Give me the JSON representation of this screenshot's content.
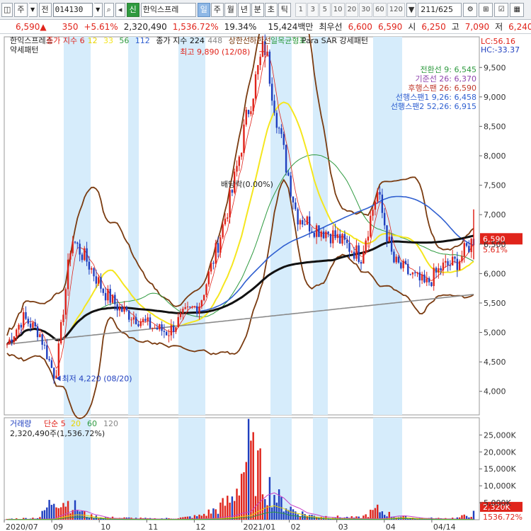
{
  "toolbar": {
    "type_label": "주",
    "prev_label": "전",
    "code": "014130",
    "tag": "신",
    "name": "한익스프레",
    "periods": [
      "일",
      "주",
      "월",
      "년",
      "분",
      "초",
      "틱"
    ],
    "active_period": "일",
    "numbers": [
      "1",
      "3",
      "5",
      "10",
      "20",
      "30",
      "60",
      "120"
    ],
    "count": "211/625"
  },
  "quote": {
    "price": "6,590▲",
    "change": "350",
    "change_pct": "+5.61%",
    "volume": "2,320,490",
    "volume_pct": "1,536.72%",
    "turnover_pct": "19.34%",
    "amount": "15,424백만",
    "best_ask_label": "최우선",
    "best_ask_1": "6,600",
    "best_ask_2": "6,590",
    "open_label": "시",
    "open": "6,250",
    "high_label": "고",
    "high": "7,090",
    "low_label": "저",
    "low": "6,240"
  },
  "price_panel": {
    "legend": [
      {
        "text": "한익스프레스",
        "color": "#222222"
      },
      {
        "text": "종가 지수 6",
        "color": "#e0241b"
      },
      {
        "text": "12",
        "color": "#e8d400"
      },
      {
        "text": "33",
        "color": "#f5e61e"
      },
      {
        "text": "56",
        "color": "#2e9a3f"
      },
      {
        "text": "112",
        "color": "#2f5fd0"
      },
      {
        "text": "종가 지수 224",
        "color": "#111111"
      },
      {
        "text": "448",
        "color": "#888888"
      },
      {
        "text": "상한선",
        "color": "#7a3b10"
      },
      {
        "text": "하한선",
        "color": "#7a3b10"
      },
      {
        "text": "일목균형표",
        "color": "#2e9a3f"
      },
      {
        "text": "Para SAR 강세패턴",
        "color": "#222222"
      }
    ],
    "legend2": "약세패턴",
    "ichimoku": [
      {
        "text": "전환선 9: 6,545",
        "color": "#2e9a3f"
      },
      {
        "text": "기준선 26: 6,370",
        "color": "#8e44ad"
      },
      {
        "text": "후행스팬 26: 6,590",
        "color": "#c0392b"
      },
      {
        "text": "선행스팬1 9,26: 6,458",
        "color": "#2f5fd0"
      },
      {
        "text": "선행스팬2 52,26: 6,915",
        "color": "#2f5fd0"
      }
    ],
    "lc": "LC:56.16",
    "hc": "HC:-33.37",
    "high_annotation": "최고 9,890 (12/08)",
    "low_annotation": "최저 4,220 (08/20)",
    "dividend_label": "배당락(0.00%)",
    "current_price_label": "6,590",
    "current_pct_label": "5.61%"
  },
  "volume_panel": {
    "legend_title": "거래량",
    "legend_ma": [
      {
        "text": "단순 5",
        "color": "#e0241b"
      },
      {
        "text": "20",
        "color": "#e8d400"
      },
      {
        "text": "60",
        "color": "#2e9a3f"
      },
      {
        "text": "120",
        "color": "#888888"
      }
    ],
    "current": "2,320,490주(1,536.72%)",
    "current_label": "2,320K",
    "current_pct_label": "1536.72%"
  },
  "x_axis": {
    "labels": [
      {
        "text": "2020/07",
        "x": 0.0
      },
      {
        "text": "09",
        "x": 0.1
      },
      {
        "text": "10",
        "x": 0.2
      },
      {
        "text": "11",
        "x": 0.3
      },
      {
        "text": "12",
        "x": 0.4
      },
      {
        "text": "2021/01",
        "x": 0.5
      },
      {
        "text": "02",
        "x": 0.6
      },
      {
        "text": "03",
        "x": 0.7
      },
      {
        "text": "04",
        "x": 0.8
      },
      {
        "text": "04/14",
        "x": 0.9
      }
    ]
  },
  "chart_data": [
    {
      "type": "line",
      "title": "한익스프레스",
      "ylabel": "",
      "ylim": [
        3600,
        9900
      ],
      "yticks": [
        "4,000",
        "4,500",
        "5,000",
        "5,500",
        "6,000",
        "6,500",
        "7,000",
        "7,500",
        "8,000",
        "8,500",
        "9,000",
        "9,500"
      ],
      "series": [
        {
          "name": "한익스프레스",
          "values": [
            4800,
            5250,
            5000,
            4220,
            6600,
            6200,
            5700,
            5400,
            5250,
            5100,
            5000,
            5300,
            5500,
            6400,
            7400,
            8800,
            9890,
            8300,
            7000,
            6800,
            6700,
            6500,
            6300,
            7400,
            6200,
            6000,
            5800,
            6100,
            6200,
            6590
          ]
        }
      ]
    },
    {
      "type": "bar",
      "title": "거래량",
      "ylabel": "",
      "yticks": [
        "5,000K",
        "10,000K",
        "15,000K",
        "20,000K",
        "25,000K"
      ],
      "series": [
        {
          "name": "거래량",
          "values": [
            300,
            500,
            800,
            9000,
            6000,
            1500,
            900,
            700,
            600,
            400,
            500,
            800,
            1500,
            4000,
            8000,
            26000,
            15000,
            7000,
            3000,
            1500,
            1200,
            900,
            800,
            4000,
            1500,
            800,
            600,
            500,
            700,
            2320
          ]
        }
      ]
    }
  ]
}
